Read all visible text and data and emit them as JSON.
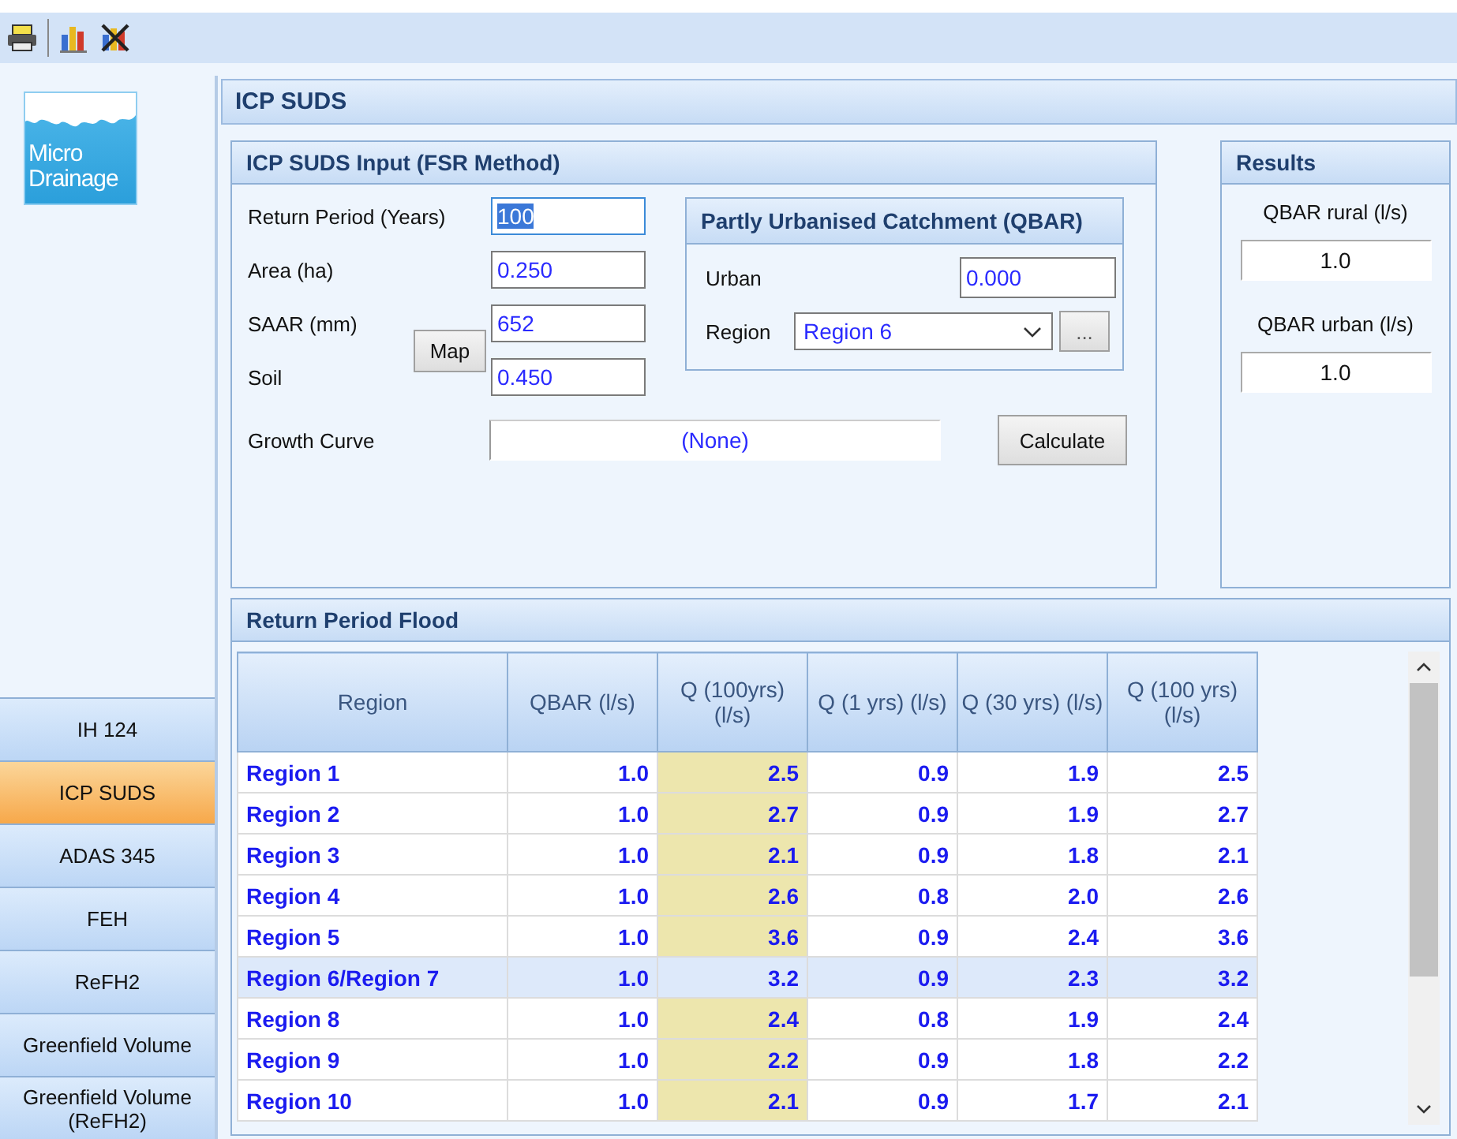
{
  "toolbar": {
    "tools": [
      {
        "kind": "print"
      },
      {
        "kind": "chart"
      },
      {
        "kind": "chart-clear"
      }
    ]
  },
  "logo": {
    "line1": "Micro",
    "line2": "Drainage"
  },
  "sidebar": {
    "items": [
      {
        "label": "IH 124",
        "selected": false
      },
      {
        "label": "ICP SUDS",
        "selected": true
      },
      {
        "label": "ADAS 345",
        "selected": false
      },
      {
        "label": "FEH",
        "selected": false
      },
      {
        "label": "ReFH2",
        "selected": false
      },
      {
        "label": "Greenfield Volume",
        "selected": false
      },
      {
        "label": "Greenfield Volume (ReFH2)",
        "selected": false
      }
    ]
  },
  "page_title": "ICP SUDS",
  "input": {
    "title": "ICP SUDS Input (FSR Method)",
    "fields": [
      {
        "label": "Return Period (Years)",
        "value": "100",
        "focused": true
      },
      {
        "label": "Area (ha)",
        "value": "0.250",
        "focused": false
      },
      {
        "label": "SAAR (mm)",
        "value": "652",
        "focused": false
      },
      {
        "label": "Soil",
        "value": "0.450",
        "focused": false
      }
    ],
    "map_button": "Map",
    "growth_curve": {
      "label": "Growth Curve",
      "value": "(None)"
    },
    "calculate_button": "Calculate",
    "urban_group": {
      "title": "Partly Urbanised Catchment (QBAR)",
      "urban_label": "Urban",
      "urban_value": "0.000",
      "region_label": "Region",
      "region_value": "Region 6",
      "more_button": "..."
    }
  },
  "results": {
    "title": "Results",
    "items": [
      {
        "label": "QBAR rural (l/s)",
        "value": "1.0"
      },
      {
        "label": "QBAR urban (l/s)",
        "value": "1.0"
      }
    ]
  },
  "flood": {
    "title": "Return Period Flood",
    "table": {
      "columns": [
        {
          "label": "Region",
          "highlighted": false
        },
        {
          "label": "QBAR (l/s)",
          "highlighted": false
        },
        {
          "label": "Q (100yrs) (l/s)",
          "highlighted": true
        },
        {
          "label": "Q (1 yrs) (l/s)",
          "highlighted": false
        },
        {
          "label": "Q (30 yrs) (l/s)",
          "highlighted": false
        },
        {
          "label": "Q (100 yrs) (l/s)",
          "highlighted": false
        }
      ],
      "rows": [
        {
          "cells": [
            "Region 1",
            "1.0",
            "2.5",
            "0.9",
            "1.9",
            "2.5"
          ],
          "selected": false
        },
        {
          "cells": [
            "Region 2",
            "1.0",
            "2.7",
            "0.9",
            "1.9",
            "2.7"
          ],
          "selected": false
        },
        {
          "cells": [
            "Region 3",
            "1.0",
            "2.1",
            "0.9",
            "1.8",
            "2.1"
          ],
          "selected": false
        },
        {
          "cells": [
            "Region 4",
            "1.0",
            "2.6",
            "0.8",
            "2.0",
            "2.6"
          ],
          "selected": false
        },
        {
          "cells": [
            "Region 5",
            "1.0",
            "3.6",
            "0.9",
            "2.4",
            "3.6"
          ],
          "selected": false
        },
        {
          "cells": [
            "Region 6/Region 7",
            "1.0",
            "3.2",
            "0.9",
            "2.3",
            "3.2"
          ],
          "selected": true
        },
        {
          "cells": [
            "Region 8",
            "1.0",
            "2.4",
            "0.8",
            "1.9",
            "2.4"
          ],
          "selected": false
        },
        {
          "cells": [
            "Region 9",
            "1.0",
            "2.2",
            "0.9",
            "1.8",
            "2.2"
          ],
          "selected": false
        },
        {
          "cells": [
            "Region 10",
            "1.0",
            "2.1",
            "0.9",
            "1.7",
            "2.1"
          ],
          "selected": false
        }
      ]
    }
  }
}
